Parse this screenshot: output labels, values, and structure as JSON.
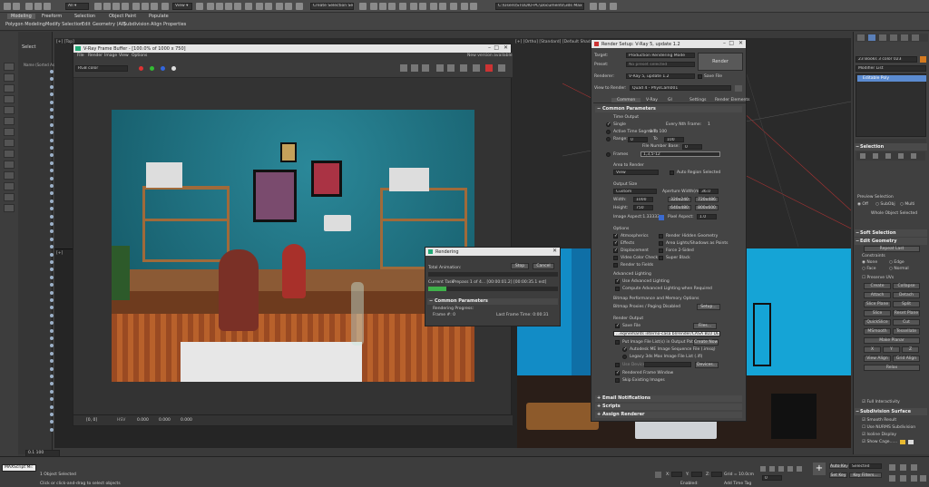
{
  "toolbar": {
    "selection_filter": "All",
    "selection_set": "Create Selection Se",
    "file_path": "C:\\Users\\STUDIO-PC\\Documents\\3ds Max 2022"
  },
  "ribbon": {
    "tabs": [
      "Modeling",
      "Freeform",
      "Selection",
      "Object Paint",
      "Populate"
    ],
    "subtabs": [
      "Polygon Modeling",
      "Modify Selection",
      "Edit",
      "Geometry (All)",
      "Subdivision",
      "Align",
      "Properties"
    ]
  },
  "scene_explorer": {
    "select_label": "Select",
    "column_header": "Name (Sorted Ascending)",
    "bottom_field": "0.1 100"
  },
  "viewports": {
    "top_left_label": "[+] [Top]",
    "top_right_label": "[+] [Ortho] [Standard] [Default Shading]",
    "top_right_status": "<<Disabled>>",
    "bottom_left_label": "[+]"
  },
  "frame_buffer": {
    "title": "V-Ray Frame Buffer - [100.0% of 1000 x 750]",
    "menu": [
      "File",
      "Render",
      "Image",
      "View",
      "Options"
    ],
    "notice": "New version available",
    "channel": "RGB color",
    "status_values": [
      "[0, 0]",
      "0.000",
      "0.000",
      "0.000"
    ],
    "status_tag": "HSV"
  },
  "rendering_dialog": {
    "title": "Rendering",
    "total_animation": "Total Animation:",
    "stop": "Stop",
    "cancel": "Cancel",
    "current_task_label": "Current Task:",
    "current_task_value": "Prepass 1 of 4... [00:00:01.2] [00:00:35.1 est]",
    "section": "Common Parameters",
    "rendering_progress": "Rendering Progress:",
    "frame_label": "Frame #: 0",
    "last_frame_time": "Last Frame Time: 0:00:31",
    "progress": 0.14
  },
  "render_setup": {
    "title": "Render Setup: V-Ray 5, update 1.2",
    "target_label": "Target:",
    "target_value": "Production Rendering Mode",
    "preset_label": "Preset:",
    "preset_value": "No preset selected",
    "renderer_label": "Renderer:",
    "renderer_value": "V-Ray 5, update 1.2",
    "save_file_label": "Save File",
    "view_label": "View to Render:",
    "view_value": "Quad 4 - PhysCam001",
    "render_button": "Render",
    "tabs": [
      "Common",
      "V-Ray",
      "GI",
      "Settings",
      "Render Elements"
    ],
    "common_params": "Common Parameters",
    "time_output": "Time Output",
    "single": "Single",
    "every_nth": "Every Nth Frame:",
    "every_nth_value": "1",
    "active_segment": "Active Time Segment:",
    "active_segment_value": "0 To 100",
    "range": "Range:",
    "range_from": "0",
    "range_to_label": "To",
    "range_to": "100",
    "file_number_base": "File Number Base:",
    "file_number_value": "0",
    "frames_label": "Frames",
    "frames_value": "1,3,5-12",
    "area_to_render": "Area to Render",
    "area_value": "View",
    "auto_region": "Auto Region Selected",
    "output_size": "Output Size",
    "size_preset": "Custom",
    "aperture_label": "Aperture Width(mm):",
    "aperture_value": "36.0",
    "width_label": "Width:",
    "width_value": "1000",
    "height_label": "Height:",
    "height_value": "750",
    "res_buttons": [
      "320x240",
      "720x486",
      "640x480",
      "800x600"
    ],
    "image_aspect": "Image Aspect:1.33333",
    "pixel_aspect": "Pixel Aspect:",
    "pixel_aspect_value": "1.0",
    "options": "Options",
    "options_left": [
      "Atmospherics",
      "Effects",
      "Displacement",
      "Video Color Check",
      "Render to Fields"
    ],
    "options_right": [
      "Render Hidden Geometry",
      "Area Lights/Shadows as Points",
      "Force 2-Sided",
      "Super Black"
    ],
    "advanced_lighting": "Advanced Lighting",
    "use_advanced_lighting": "Use Advanced Lighting",
    "compute_advanced": "Compute Advanced Lighting when Required",
    "bitmap_perf": "Bitmap Performance and Memory Options",
    "bitmap_proxies": "Bitmap Proxies / Paging Disabled",
    "setup_button": "Setup...",
    "render_output": "Render Output",
    "save_file": "Save File",
    "files_button": "Files...",
    "output_path": "...eqinemants interno-casa bl/render/CASA BLU DEF.png",
    "put_image": "Put Image File List(s) in Output Path(s)",
    "create_now": "Create Now",
    "autodesk_seq": "Autodesk ME Image Sequence File (.imsq)",
    "legacy_seq": "Legacy 3ds Max Image File List (.ifl)",
    "use_device": "Use Device",
    "devices_button": "Devices...",
    "rendered_frame_window": "Rendered Frame Window",
    "skip_existing": "Skip Existing Images",
    "collapsed": [
      "Email Notifications",
      "Scripts",
      "Assign Renderer"
    ]
  },
  "command_panel": {
    "object_name": "23 Books 3 color 023",
    "modifier_list": "Modifier List",
    "stack_item": "Editable Poly",
    "selection": "Selection",
    "preview_selection": "Preview Selection",
    "off": "Off",
    "subobj": "SubObj",
    "multi": "Multi",
    "whole_object": "Whole Object Selected",
    "soft_selection": "Soft Selection",
    "edit_geometry": "Edit Geometry",
    "repeat_last": "Repeat Last",
    "constraints": "Constraints",
    "constraint_opts": [
      "None",
      "Edge",
      "Face",
      "Normal"
    ],
    "preserve_uvs": "Preserve UVs",
    "ops": [
      "Create",
      "Collapse",
      "Attach",
      "Detach",
      "Slice Plane",
      "Split",
      "Slice",
      "Reset Plane",
      "QuickSlice",
      "Cut",
      "MSmooth",
      "Tessellate",
      "Make Planar",
      "X",
      "Y",
      "Z",
      "View Align",
      "Grid Align",
      "Relax"
    ],
    "subdivision_surface": "Subdivision Surface",
    "smooth_result": "Smooth Result",
    "use_nurms": "Use NURMS Subdivision",
    "isoline": "Isoline Display",
    "show_cage": "Show Cage......",
    "full_interactivity": "Full Interactivity"
  },
  "statusbar": {
    "script_label": "MAXScript Mi:",
    "selected": "1 Object Selected",
    "hint": "Click or click-and-drag to select objects",
    "x_label": "X:",
    "y_label": "Y:",
    "z_label": "Z:",
    "grid": "Grid = 10.0cm",
    "add_time_tag": "Add Time Tag",
    "enabled": "Enabled:",
    "frame": "0",
    "auto_key": "Auto Key",
    "set_key": "Set Key",
    "selected_dd": "Selected",
    "key_filters": "Key Filters..."
  },
  "colors": {
    "accent": "#5b8bd0",
    "wall": "#1d6f7e",
    "progress_green": "#3fb24a"
  }
}
